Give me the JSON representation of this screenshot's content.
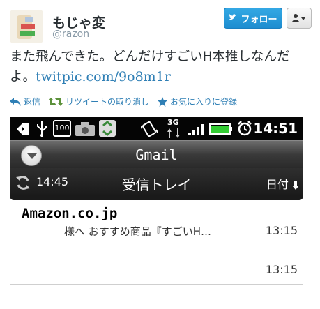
{
  "tweet": {
    "display_name": "もじゃ変",
    "screen_name": "@razon",
    "follow_label": "フォロー",
    "text_prefix": "また飛んできた。どんだけすごいH本推しなんだよ。",
    "link_text": "twitpic.com/9o8m1r",
    "actions": {
      "reply": "返信",
      "retweet": "リツイートの取り消し",
      "favorite": "お気に入りに登録"
    }
  },
  "phone": {
    "status_time": "14:51",
    "status_icons": [
      "notification-icon",
      "usb-icon",
      "battery-100-icon",
      "camera-icon",
      "recycle-icon",
      "vibrate-icon",
      "3g-icon",
      "signal-icon",
      "battery-icon",
      "alarm-icon"
    ],
    "status_labels": {
      "battery_badge": "100",
      "network": "3G"
    },
    "app_title": "Gmail",
    "sync_time": "14:45",
    "inbox_title": "受信トレイ",
    "sort_label": "日付",
    "mails": [
      {
        "sender": "Amazon.co.jp",
        "snippet": "様へ おすすめ商品『すごいH…",
        "time": "13:15"
      },
      {
        "sender": "",
        "snippet": "",
        "time": "13:15"
      }
    ]
  },
  "colors": {
    "link": "#2f7fb5",
    "follow_button": "#2b9fe0"
  }
}
